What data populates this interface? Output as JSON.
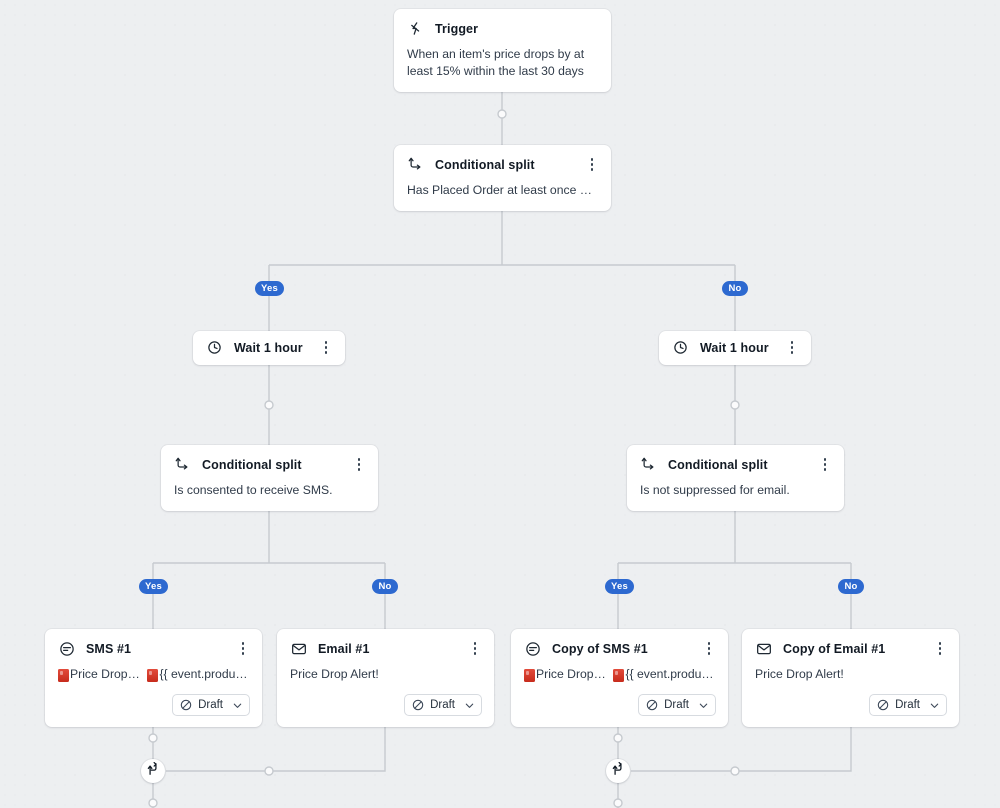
{
  "canvas": {
    "background_color": "#edeff1",
    "accent_color": "#2d69d0",
    "card_color": "#ffffff",
    "edge_color": "#c6cacf"
  },
  "nodes": {
    "trigger": {
      "icon": "lightning-bolt-icon",
      "title": "Trigger",
      "body": "When an item's price drops by at least 15% within the last 30 days"
    },
    "split_root": {
      "icon": "conditional-split-icon",
      "title": "Conditional split",
      "body": "Has Placed Order at least once over all ti…",
      "menu": "kebab-menu-icon"
    },
    "wait_left": {
      "icon": "clock-icon",
      "title": "Wait 1 hour",
      "menu": "kebab-menu-icon"
    },
    "wait_right": {
      "icon": "clock-icon",
      "title": "Wait 1 hour",
      "menu": "kebab-menu-icon"
    },
    "split_left": {
      "icon": "conditional-split-icon",
      "title": "Conditional split",
      "body": "Is consented to receive SMS.",
      "menu": "kebab-menu-icon"
    },
    "split_right": {
      "icon": "conditional-split-icon",
      "title": "Conditional split",
      "body": "Is not suppressed for email.",
      "menu": "kebab-menu-icon"
    },
    "sms_1": {
      "icon": "sms-icon",
      "title": "SMS #1",
      "message_part_1": "Price Drop Alert!",
      "message_part_2": "{{ event.product_n…",
      "emoji": "rotating-light-emoji",
      "status": "Draft",
      "status_icon": "draft-slash-icon",
      "chevron": "chevron-down-icon",
      "menu": "kebab-menu-icon"
    },
    "email_1": {
      "icon": "envelope-icon",
      "title": "Email #1",
      "message": "Price Drop Alert!",
      "status": "Draft",
      "status_icon": "draft-slash-icon",
      "chevron": "chevron-down-icon",
      "menu": "kebab-menu-icon"
    },
    "sms_copy": {
      "icon": "sms-icon",
      "title": "Copy of SMS #1",
      "message_part_1": "Price Drop Alert!",
      "message_part_2": "{{ event.product_n…",
      "emoji": "rotating-light-emoji",
      "status": "Draft",
      "status_icon": "draft-slash-icon",
      "chevron": "chevron-down-icon",
      "menu": "kebab-menu-icon"
    },
    "email_copy": {
      "icon": "envelope-icon",
      "title": "Copy of Email #1",
      "message": "Price Drop Alert!",
      "status": "Draft",
      "status_icon": "draft-slash-icon",
      "chevron": "chevron-down-icon",
      "menu": "kebab-menu-icon"
    }
  },
  "branches": {
    "root_yes": "Yes",
    "root_no": "No",
    "left_yes": "Yes",
    "left_no": "No",
    "right_yes": "Yes",
    "right_no": "No"
  },
  "markers": {
    "loop_left": "conditional-split-icon",
    "loop_right": "conditional-split-icon"
  }
}
